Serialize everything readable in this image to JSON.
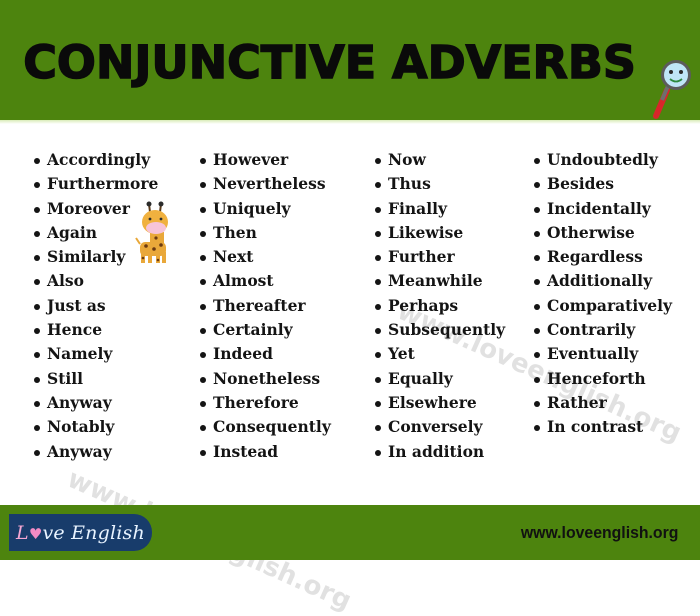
{
  "header": {
    "title": "CONJUNCTIVE ADVERBS",
    "decoration_icon": "magnifier-mascot-icon",
    "background_color": "#4d840e"
  },
  "columns": [
    {
      "items": [
        "Accordingly",
        "Furthermore",
        "Moreover",
        "Again",
        "Similarly",
        "Also",
        "Just as",
        "Hence",
        "Namely",
        "Still",
        "Anyway",
        "Notably",
        "Anyway"
      ]
    },
    {
      "items": [
        "However",
        "Nevertheless",
        "Uniquely",
        "Then",
        "Next",
        "Almost",
        "Thereafter",
        "Certainly",
        "Indeed",
        "Nonetheless",
        "Therefore",
        "Consequently",
        "Instead"
      ]
    },
    {
      "items": [
        "Now",
        "Thus",
        "Finally",
        "Likewise",
        "Further",
        "Meanwhile",
        "Perhaps",
        "Subsequently",
        "Yet",
        "Equally",
        "Elsewhere",
        "Conversely",
        "In addition"
      ]
    },
    {
      "items": [
        "Undoubtedly",
        "Besides",
        "Incidentally",
        "Otherwise",
        "Regardless",
        "Additionally",
        "Comparatively",
        "Contrarily",
        "Eventually",
        "Henceforth",
        "Rather",
        "In contrast"
      ]
    }
  ],
  "watermarks": [
    "www.loveenglish.org",
    "www.loveenglish.org"
  ],
  "footer": {
    "logo": {
      "letter_l": "L",
      "heart": "♥",
      "rest": "ve English"
    },
    "url": "www.loveenglish.org",
    "background_color": "#4d840e",
    "logo_color": "#183c6b"
  }
}
